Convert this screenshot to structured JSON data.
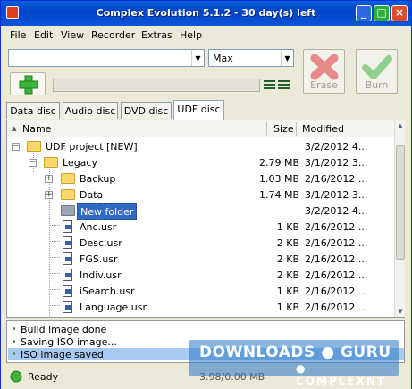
{
  "window": {
    "title": "Complex Evolution 5.1.2 - 30 day(s) left",
    "minimize": "_",
    "maximize": "□",
    "close": "×"
  },
  "menu": [
    "File",
    "Edit",
    "View",
    "Recorder",
    "Extras",
    "Help"
  ],
  "toolbar": {
    "drive_value": "",
    "speed_value": "Max",
    "erase_label": "Erase",
    "burn_label": "Burn",
    "add_icon": "plus-icon",
    "view_icon": "list-view-icon"
  },
  "tabs": [
    {
      "label": "Data disc",
      "active": false
    },
    {
      "label": "Audio disc",
      "active": false
    },
    {
      "label": "DVD disc",
      "active": false
    },
    {
      "label": "UDF disc",
      "active": true
    }
  ],
  "columns": {
    "name": "Name",
    "size": "Size",
    "modified": "Modified"
  },
  "tree": [
    {
      "name": "UDF project [NEW]",
      "size": "",
      "modified": "3/2/2012 4...",
      "kind": "folder",
      "expander": "−"
    },
    {
      "name": "Legacy",
      "size": "2.79 MB",
      "modified": "3/1/2012 3...",
      "kind": "folder",
      "expander": "−"
    },
    {
      "name": "Backup",
      "size": "1.03 MB",
      "modified": "2/16/2012 ...",
      "kind": "folder",
      "expander": "+"
    },
    {
      "name": "Data",
      "size": "1.74 MB",
      "modified": "3/1/2012 3...",
      "kind": "folder",
      "expander": "+"
    },
    {
      "name": "New folder",
      "size": "",
      "modified": "3/2/2012 4...",
      "kind": "folder-grey",
      "expander": ""
    },
    {
      "name": "Anc.usr",
      "size": "1 KB",
      "modified": "2/16/2012 ...",
      "kind": "file",
      "expander": ""
    },
    {
      "name": "Desc.usr",
      "size": "2 KB",
      "modified": "2/16/2012 ...",
      "kind": "file",
      "expander": ""
    },
    {
      "name": "FGS.usr",
      "size": "2 KB",
      "modified": "2/16/2012 ...",
      "kind": "file",
      "expander": ""
    },
    {
      "name": "Indiv.usr",
      "size": "2 KB",
      "modified": "2/16/2012 ...",
      "kind": "file",
      "expander": ""
    },
    {
      "name": "iSearch.usr",
      "size": "1 KB",
      "modified": "2/16/2012 ...",
      "kind": "file",
      "expander": ""
    },
    {
      "name": "Language.usr",
      "size": "1 KB",
      "modified": "2/16/2012 ...",
      "kind": "file",
      "expander": ""
    }
  ],
  "log": [
    "Build image done",
    "Saving ISO image...",
    "ISO image saved"
  ],
  "status": {
    "text": "Ready",
    "capacity": "3.98/0.00 MB"
  },
  "watermark": {
    "main": "DOWNLOADS ● GURU",
    "sub": "● COMPLEXNT"
  },
  "colors": {
    "titlebar": "#0044c8",
    "selection": "#316ac5",
    "accent_green": "#3cb43c",
    "erase_red": "#e05050"
  }
}
